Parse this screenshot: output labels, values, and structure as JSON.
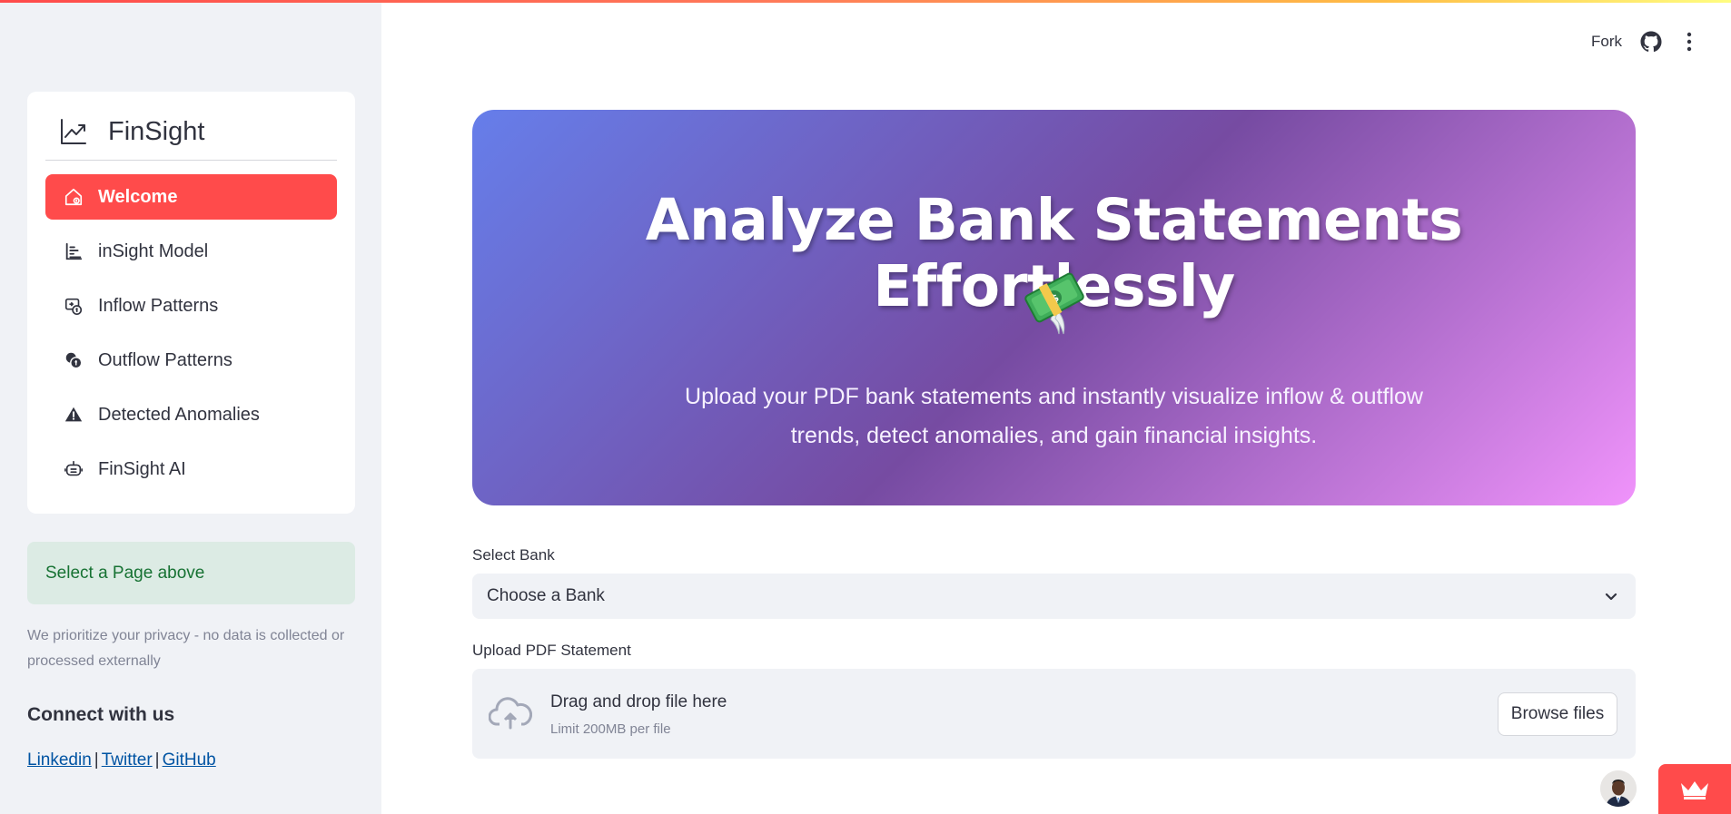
{
  "sidebar": {
    "brand": {
      "title": "FinSight",
      "icon": "trend-chart-icon"
    },
    "nav": [
      {
        "label": "Welcome",
        "icon": "home-icon",
        "active": true
      },
      {
        "label": "inSight Model",
        "icon": "bar-list-icon",
        "active": false
      },
      {
        "label": "Inflow Patterns",
        "icon": "money-inflow-icon",
        "active": false
      },
      {
        "label": "Outflow Patterns",
        "icon": "coins-outflow-icon",
        "active": false
      },
      {
        "label": "Detected Anomalies",
        "icon": "warning-icon",
        "active": false
      },
      {
        "label": "FinSight AI",
        "icon": "robot-icon",
        "active": false
      }
    ],
    "info_message": "Select a Page above",
    "privacy_note": "We prioritize your privacy - no data is collected or processed externally",
    "connect_heading": "Connect with us",
    "links": [
      "Linkedin",
      "Twitter",
      "GitHub"
    ],
    "link_separator": "|"
  },
  "header": {
    "fork_label": "Fork",
    "github_icon": "github-icon",
    "menu_icon": "kebab-menu-icon"
  },
  "hero": {
    "title": "Analyze Bank Statements Effortlessly",
    "emoji": "money-with-wings-icon",
    "subtitle": "Upload your PDF bank statements and instantly visualize inflow & outflow trends, detect anomalies, and gain financial insights."
  },
  "bank_select": {
    "label": "Select Bank",
    "value": "Choose a Bank"
  },
  "upload": {
    "label": "Upload PDF Statement",
    "drop_text": "Drag and drop file here",
    "limit_text": "Limit 200MB per file",
    "browse_label": "Browse files"
  },
  "colors": {
    "accent": "#ff4b4b",
    "sidebar_bg": "#f0f2f6",
    "hero_gradient": [
      "#667eea",
      "#764ba2",
      "#f093fb"
    ],
    "success_bg": "#dcebe4",
    "success_text": "#177233",
    "link": "#0054a3"
  }
}
